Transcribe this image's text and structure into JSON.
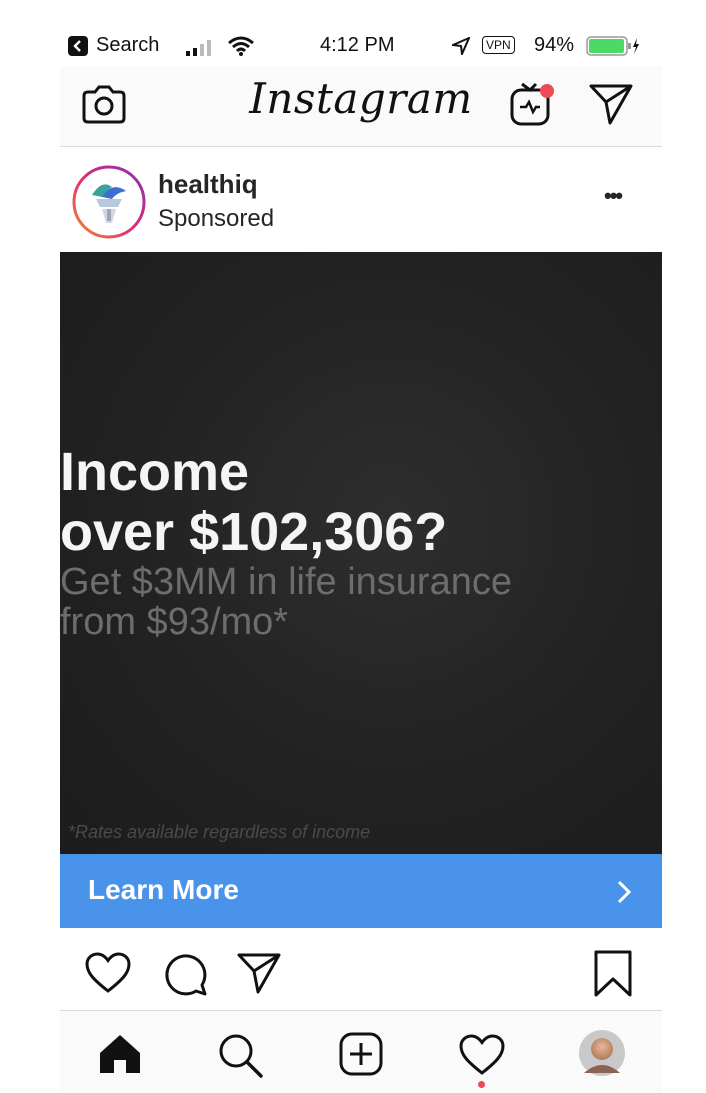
{
  "status_bar": {
    "back_app": "Search",
    "time": "4:12 PM",
    "vpn": "VPN",
    "battery": "94%"
  },
  "top_nav": {
    "logo_text": "Instagram",
    "icons": [
      "camera-icon",
      "igtv-icon",
      "direct-message-icon"
    ]
  },
  "post": {
    "username": "healthiq",
    "subtitle": "Sponsored",
    "more": "•••",
    "ad": {
      "headline_1": "Income",
      "headline_2": "over $102,306?",
      "sub_1": "Get $3MM in life insurance",
      "sub_2": "from $93/mo*",
      "disclaimer": "*Rates available regardless of income"
    },
    "cta": {
      "label": "Learn More",
      "color": "#4a93ea"
    },
    "actions": [
      "like-icon",
      "comment-icon",
      "share-icon",
      "bookmark-icon"
    ]
  },
  "tab_bar": {
    "items": [
      "home-icon",
      "search-icon",
      "new-post-icon",
      "activity-icon",
      "profile-avatar"
    ],
    "notification_color": "#ed4956"
  }
}
